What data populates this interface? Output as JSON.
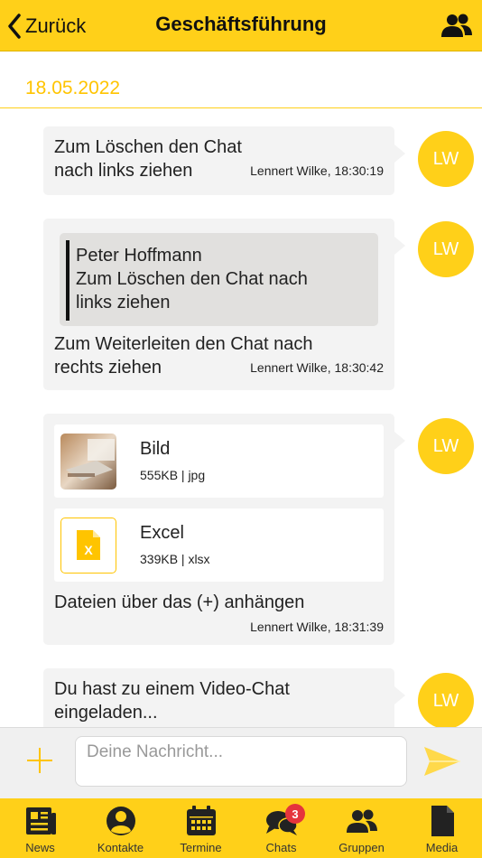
{
  "header": {
    "back_label": "Zurück",
    "title": "Geschäftsführung"
  },
  "date_separator": "18.05.2022",
  "messages": [
    {
      "initials": "LW",
      "text": "Zum Löschen den Chat nach links ziehen",
      "sender_time": "Lennert Wilke, 18:30:19"
    },
    {
      "initials": "LW",
      "quote_author": "Peter Hoffmann",
      "quote_text": "Zum Löschen den Chat nach links ziehen",
      "text": "Zum Weiterleiten den Chat nach rechts ziehen",
      "sender_time": "Lennert Wilke, 18:30:42"
    },
    {
      "initials": "LW",
      "files": [
        {
          "name": "Bild",
          "meta": "555KB | jpg"
        },
        {
          "name": "Excel",
          "meta": "339KB | xlsx"
        }
      ],
      "text": "Dateien über das (+) anhängen",
      "sender_time": "Lennert Wilke, 18:31:39"
    },
    {
      "initials": "LW",
      "text": "Du hast zu einem Video-Chat eingeladen..."
    }
  ],
  "composer": {
    "placeholder": "Deine Nachricht..."
  },
  "tabs": [
    {
      "label": "News",
      "icon": "news-icon"
    },
    {
      "label": "Kontakte",
      "icon": "contact-icon"
    },
    {
      "label": "Termine",
      "icon": "calendar-icon"
    },
    {
      "label": "Chats",
      "icon": "chat-icon",
      "badge": "3"
    },
    {
      "label": "Gruppen",
      "icon": "group-icon"
    },
    {
      "label": "Media",
      "icon": "document-icon"
    }
  ],
  "colors": {
    "accent": "#ffd019",
    "badge": "#e5343c",
    "bubble": "#f3f3f3"
  }
}
